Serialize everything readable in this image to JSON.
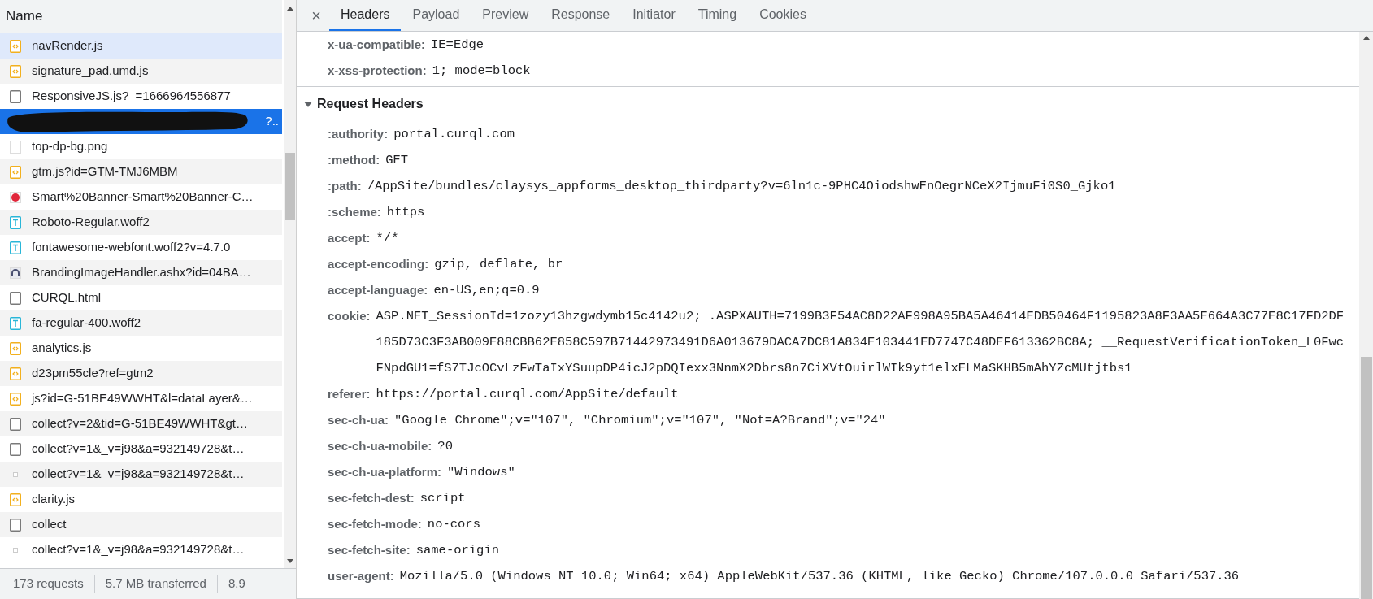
{
  "request_list": {
    "column": "Name",
    "rows": [
      {
        "name": "navRender.js",
        "kind": "script",
        "selected": false,
        "hovered": true
      },
      {
        "name": "signature_pad.umd.js",
        "kind": "script",
        "selected": false,
        "hovered": false
      },
      {
        "name": "ResponsiveJS.js?_=1666964556877",
        "kind": "document",
        "selected": false,
        "hovered": false
      },
      {
        "name": "?..",
        "selected": true,
        "redacted": true
      },
      {
        "name": "top-dp-bg.png",
        "kind": "blank",
        "selected": false,
        "hovered": false
      },
      {
        "name": "gtm.js?id=GTM-TMJ6MBM",
        "kind": "script",
        "selected": false,
        "hovered": false
      },
      {
        "name": "Smart%20Banner-Smart%20Banner-C…",
        "kind": "image",
        "selected": false,
        "hovered": false
      },
      {
        "name": "Roboto-Regular.woff2",
        "kind": "font",
        "selected": false,
        "hovered": false
      },
      {
        "name": "fontawesome-webfont.woff2?v=4.7.0",
        "kind": "font",
        "selected": false,
        "hovered": false
      },
      {
        "name": "BrandingImageHandler.ashx?id=04BA…",
        "kind": "other",
        "selected": false,
        "hovered": false
      },
      {
        "name": "CURQL.html",
        "kind": "document",
        "selected": false,
        "hovered": false
      },
      {
        "name": "fa-regular-400.woff2",
        "kind": "font",
        "selected": false,
        "hovered": false
      },
      {
        "name": "analytics.js",
        "kind": "script",
        "selected": false,
        "hovered": false
      },
      {
        "name": "d23pm55cle?ref=gtm2",
        "kind": "script",
        "selected": false,
        "hovered": false
      },
      {
        "name": "js?id=G-51BE49WWHT&l=dataLayer&…",
        "kind": "script",
        "selected": false,
        "hovered": false
      },
      {
        "name": "collect?v=2&tid=G-51BE49WWHT&gt…",
        "kind": "document",
        "selected": false,
        "hovered": false
      },
      {
        "name": "collect?v=1&_v=j98&a=932149728&t…",
        "kind": "document",
        "selected": false,
        "hovered": false
      },
      {
        "name": "collect?v=1&_v=j98&a=932149728&t…",
        "kind": "ping",
        "selected": false,
        "hovered": false
      },
      {
        "name": "clarity.js",
        "kind": "script",
        "selected": false,
        "hovered": false
      },
      {
        "name": "collect",
        "kind": "document",
        "selected": false,
        "hovered": false
      },
      {
        "name": "collect?v=1&_v=j98&a=932149728&t…",
        "kind": "ping",
        "selected": false,
        "hovered": false
      }
    ]
  },
  "status_bar": [
    "173 requests",
    "5.7 MB transferred",
    "8.9"
  ],
  "close": "×",
  "tabs": [
    {
      "label": "Headers",
      "selected": true
    },
    {
      "label": "Payload",
      "selected": false
    },
    {
      "label": "Preview",
      "selected": false
    },
    {
      "label": "Response",
      "selected": false
    },
    {
      "label": "Initiator",
      "selected": false
    },
    {
      "label": "Timing",
      "selected": false
    },
    {
      "label": "Cookies",
      "selected": false
    }
  ],
  "response_headers": [
    {
      "name": "x-ua-compatible:",
      "value": "IE=Edge"
    },
    {
      "name": "x-xss-protection:",
      "value": "1; mode=block"
    }
  ],
  "request_headers": {
    "title": "Request Headers",
    "expanded": true,
    "rows": [
      {
        "name": ":authority:",
        "value": "portal.curql.com"
      },
      {
        "name": ":method:",
        "value": "GET"
      },
      {
        "name": ":path:",
        "value": "/AppSite/bundles/claysys_appforms_desktop_thirdparty?v=6ln1c-9PHC4OiodshwEnOegrNCeX2IjmuFi0S0_Gjko1"
      },
      {
        "name": ":scheme:",
        "value": "https"
      },
      {
        "name": "accept:",
        "value": "*/*"
      },
      {
        "name": "accept-encoding:",
        "value": "gzip, deflate, br"
      },
      {
        "name": "accept-language:",
        "value": "en-US,en;q=0.9"
      },
      {
        "name": "cookie:",
        "value": "ASP.NET_SessionId=1zozy13hzgwdymb15c4142u2; .ASPXAUTH=7199B3F54AC8D22AF998A95BA5A46414EDB50464F1195823A8F3AA5E664A3C77E8C17FD2DF185D73C3F3AB009E88CBB62E858C597B71442973491D6A013679DACA7DC81A834E103441ED7747C48DEF613362BC8A; __RequestVerificationToken_L0FwcFNpdGU1=fS7TJcOCvLzFwTaIxYSuupDP4icJ2pDQIexx3NnmX2Dbrs8n7CiXVtOuirlWIk9yt1elxELMaSKHB5mAhYZcMUtjtbs1"
      },
      {
        "name": "referer:",
        "value": "https://portal.curql.com/AppSite/default"
      },
      {
        "name": "sec-ch-ua:",
        "value": "\"Google Chrome\";v=\"107\", \"Chromium\";v=\"107\", \"Not=A?Brand\";v=\"24\""
      },
      {
        "name": "sec-ch-ua-mobile:",
        "value": "?0"
      },
      {
        "name": "sec-ch-ua-platform:",
        "value": "\"Windows\""
      },
      {
        "name": "sec-fetch-dest:",
        "value": "script"
      },
      {
        "name": "sec-fetch-mode:",
        "value": "no-cors"
      },
      {
        "name": "sec-fetch-site:",
        "value": "same-origin"
      },
      {
        "name": "user-agent:",
        "value": "Mozilla/5.0 (Windows NT 10.0; Win64; x64) AppleWebKit/537.36 (KHTML, like Gecko) Chrome/107.0.0.0 Safari/537.36"
      }
    ]
  }
}
